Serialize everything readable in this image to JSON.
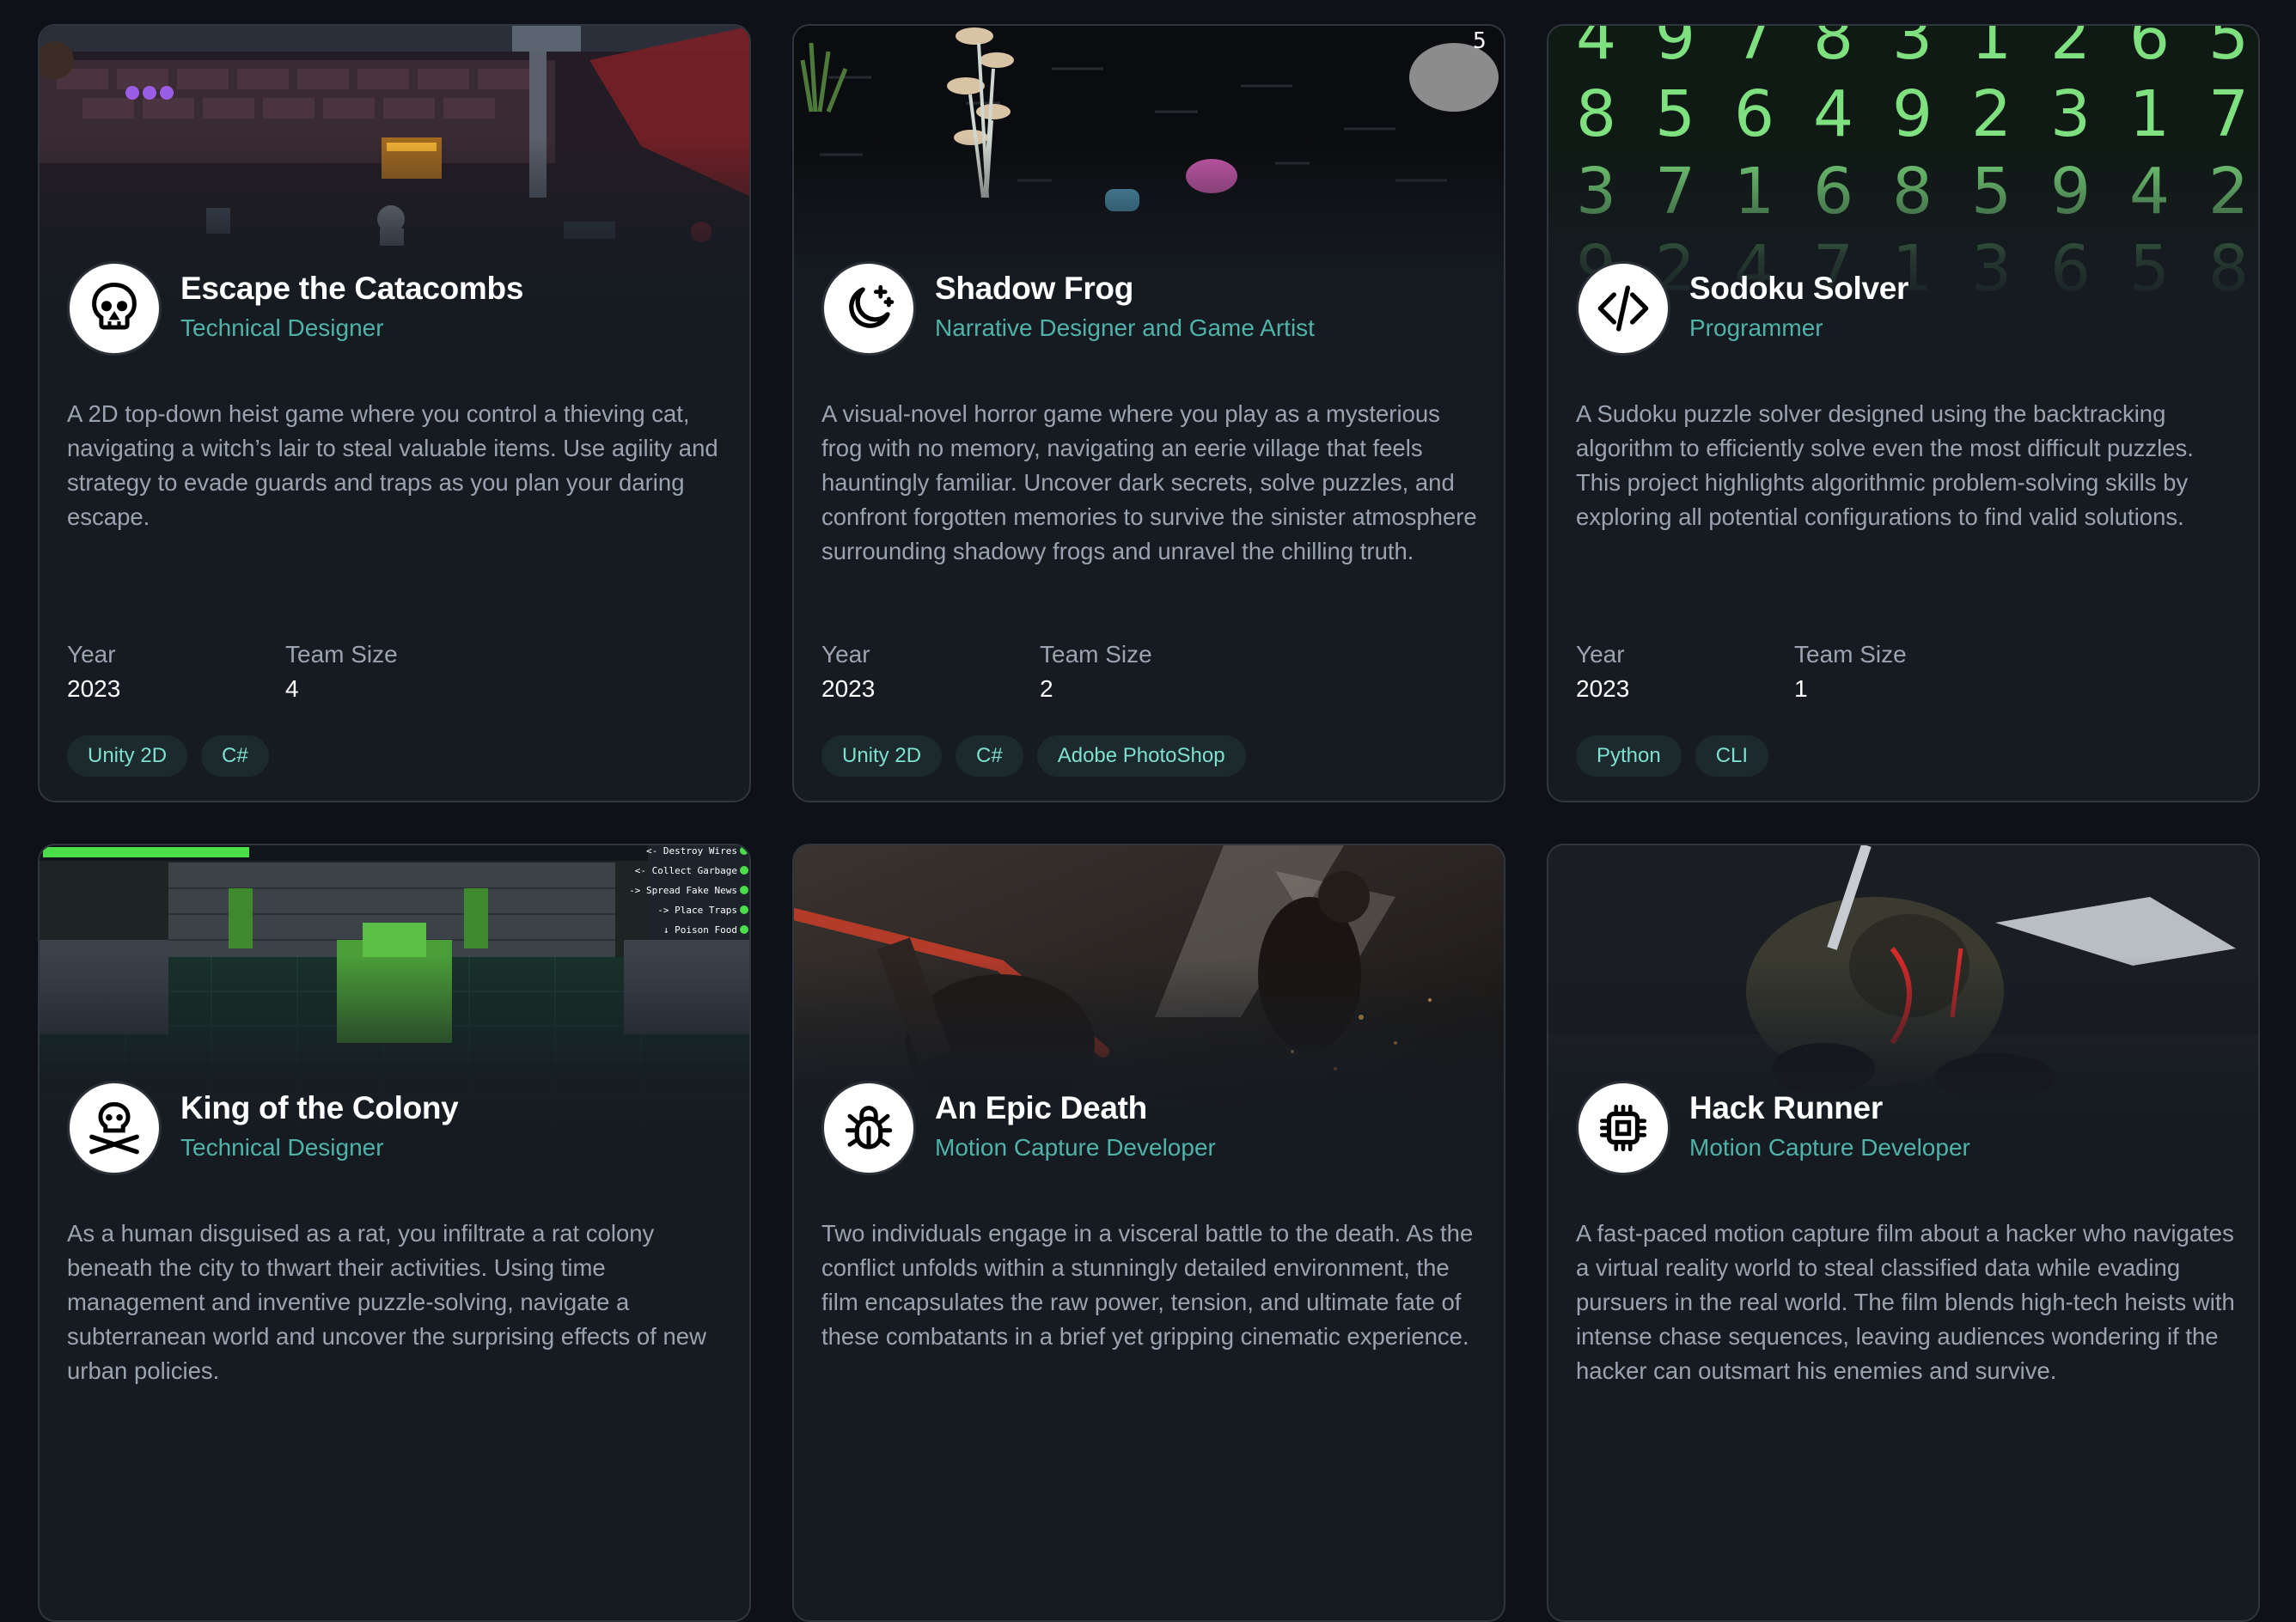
{
  "labels": {
    "year": "Year",
    "team_size": "Team Size"
  },
  "projects": [
    {
      "title": "Escape the Catacombs",
      "role": "Technical Designer",
      "description": "A 2D top-down heist game where you control a thieving cat, navigating a witch’s lair to steal valuable items. Use agility and strategy to evade guards and traps as you plan your daring escape.",
      "year": "2023",
      "team_size": "4",
      "tags": [
        "Unity 2D",
        "C#"
      ],
      "icon": "skull-icon"
    },
    {
      "title": "Shadow Frog",
      "role": "Narrative Designer and Game Artist",
      "description": "A visual-novel horror game where you play as a mysterious frog with no memory, navigating an eerie village that feels hauntingly familiar. Uncover dark secrets, solve puzzles, and confront forgotten memories to survive the sinister atmosphere surrounding shadowy frogs and unravel the chilling truth.",
      "year": "2023",
      "team_size": "2",
      "tags": [
        "Unity 2D",
        "C#",
        "Adobe PhotoShop"
      ],
      "icon": "moon-star-icon"
    },
    {
      "title": "Sodoku Solver",
      "role": "Programmer",
      "description": "A Sudoku puzzle solver designed using the backtracking algorithm to efficiently solve even the most difficult puzzles. This project highlights algorithmic problem-solving skills by exploring all potential configurations to find valid solutions.",
      "year": "2023",
      "team_size": "1",
      "tags": [
        "Python",
        "CLI"
      ],
      "icon": "code-icon",
      "image_digits": [
        [
          "4",
          "9",
          "7",
          "8",
          "3",
          "1",
          "2",
          "6",
          "5"
        ],
        [
          "8",
          "5",
          "6",
          "4",
          "9",
          "2",
          "3",
          "1",
          "7"
        ],
        [
          "3",
          "7",
          "1",
          "6",
          "8",
          "5",
          "9",
          "4",
          "2"
        ],
        [
          "9",
          "2",
          "4",
          "7",
          "1",
          "3",
          "6",
          "5",
          "8"
        ]
      ]
    },
    {
      "title": "King of the Colony",
      "role": "Technical Designer",
      "description": "As a human disguised as a rat, you infiltrate a rat colony beneath the city to thwart their activities. Using time management and inventive puzzle-solving, navigate a subterranean world and uncover the surprising effects of new urban policies.",
      "icon": "skull-crossbones-icon",
      "image_tasks": [
        "<- Destroy Wires",
        "<- Collect Garbage",
        "-> Spread Fake News",
        "-> Place Traps",
        "↓ Poison Food"
      ]
    },
    {
      "title": "An Epic Death",
      "role": "Motion Capture Developer",
      "description": "Two individuals engage in a visceral battle to the death. As the conflict unfolds within a stunningly detailed environment, the film encapsulates the raw power, tension, and ultimate fate of these combatants in a brief yet gripping cinematic experience.",
      "icon": "bug-icon"
    },
    {
      "title": "Hack Runner",
      "role": "Motion Capture Developer",
      "description": "A fast-paced motion capture film about a hacker who navigates a virtual reality world to steal classified data while evading pursuers in the real world. The film blends high-tech heists with intense chase sequences, leaving audiences wondering if the hacker can outsmart his enemies and survive.",
      "icon": "chip-icon"
    }
  ]
}
